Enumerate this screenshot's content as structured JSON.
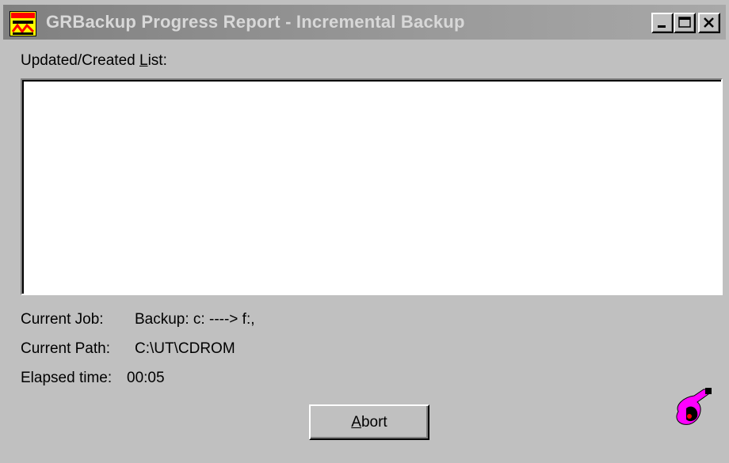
{
  "window": {
    "title": "GRBackup Progress Report - Incremental Backup",
    "icons": {
      "app": "grbackup-app-icon",
      "minimize": "minimize-icon",
      "maximize": "maximize-icon",
      "close": "close-icon",
      "activity": "backup-activity-icon"
    }
  },
  "list": {
    "label_prefix": "Updated/Created ",
    "label_accel": "L",
    "label_suffix": "ist:",
    "items": []
  },
  "info": {
    "current_job_label": "Current Job:",
    "current_job_value": "Backup: c: ----> f:,",
    "current_path_label": "Current Path:",
    "current_path_value": "C:\\UT\\CDROM",
    "elapsed_label": "Elapsed time:",
    "elapsed_value": "00:05"
  },
  "buttons": {
    "abort_accel": "A",
    "abort_rest": "bort"
  },
  "colors": {
    "face": "#c0c0c0",
    "title_inactive": "#808080",
    "icon_magenta": "#ff00ff"
  }
}
